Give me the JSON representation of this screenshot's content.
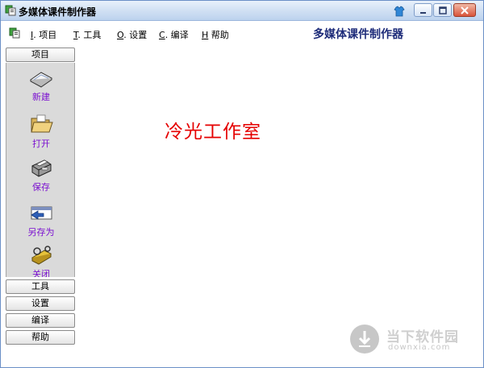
{
  "window": {
    "title": "多媒体课件制作器"
  },
  "menubar": {
    "items": [
      {
        "key": "I",
        "label": ". 项目"
      },
      {
        "key": "T",
        "label": ". 工具"
      },
      {
        "key": "O",
        "label": ". 设置"
      },
      {
        "key": "C",
        "label": ". 编译"
      },
      {
        "key": "H",
        "label": " 帮助"
      }
    ],
    "app_title": "多媒体课件制作器"
  },
  "sidebar": {
    "sections": [
      "项目",
      "工具",
      "设置",
      "编译",
      "帮助"
    ],
    "tools": [
      {
        "label": "新建",
        "icon": "new-file-icon"
      },
      {
        "label": "打开",
        "icon": "open-folder-icon"
      },
      {
        "label": "保存",
        "icon": "save-printer-icon"
      },
      {
        "label": "另存为",
        "icon": "save-as-icon"
      },
      {
        "label": "关闭",
        "icon": "close-icon"
      }
    ]
  },
  "content": {
    "text": "冷光工作室"
  },
  "watermark": {
    "brand": "当下软件园",
    "url": "downxia.com"
  },
  "colors": {
    "content_text": "#e50000",
    "tool_label": "#7a0fd0",
    "title_blue": "#1d2b79"
  }
}
